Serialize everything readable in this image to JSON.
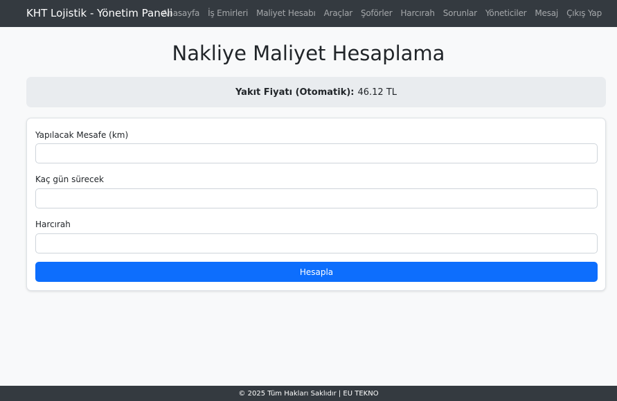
{
  "navbar": {
    "brand": "KHT Lojistik - Yönetim Paneli",
    "links": [
      "Anasayfa",
      "İş Emirleri",
      "Maliyet Hesabı",
      "Araçlar",
      "Şoförler",
      "Harcırah",
      "Sorunlar",
      "Yöneticiler",
      "Mesaj",
      "Çıkış Yap"
    ]
  },
  "page": {
    "title": "Nakliye Maliyet Hesaplama"
  },
  "fuel": {
    "label": "Yakıt Fiyatı (Otomatik):",
    "value": "46.12 TL"
  },
  "form": {
    "distance_label": "Yapılacak Mesafe (km)",
    "distance_value": "",
    "days_label": "Kaç gün sürecek",
    "days_value": "",
    "allowance_label": "Harcırah",
    "allowance_value": "",
    "submit_label": "Hesapla"
  },
  "footer": {
    "text": "© 2025 Tüm Hakları Saklıdır | EU TEKNO"
  },
  "colors": {
    "navbar_bg": "#343a40",
    "primary": "#0d6efd",
    "page_bg": "#f8f9fa"
  }
}
